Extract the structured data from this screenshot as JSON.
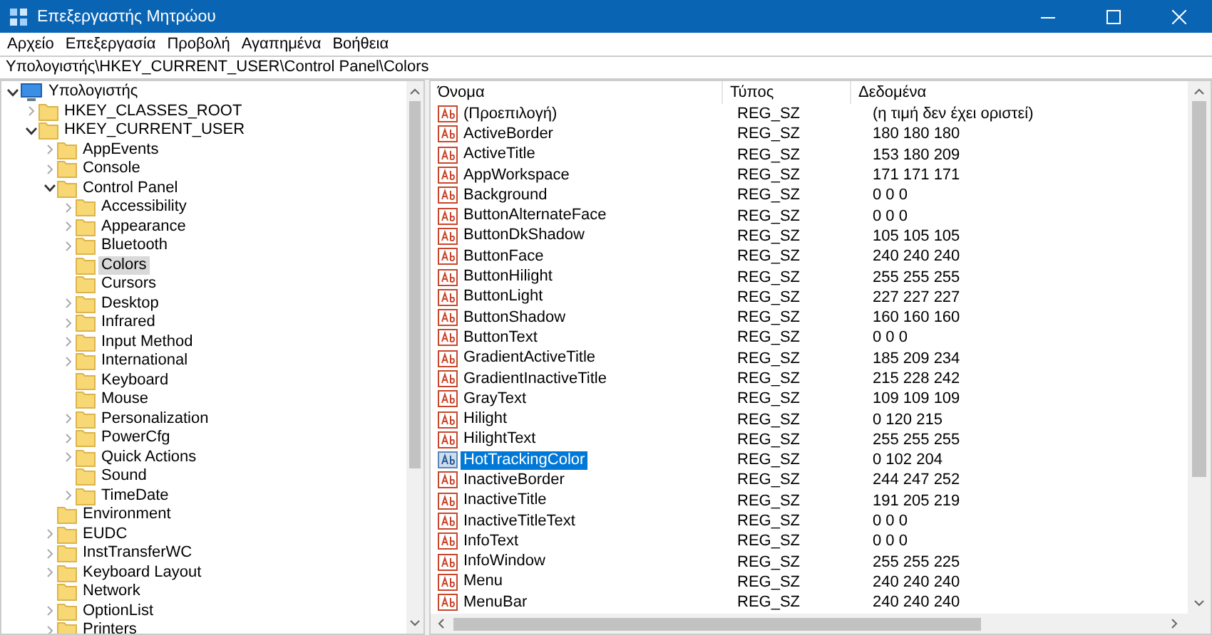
{
  "window": {
    "title": "Επεξεργαστής Μητρώου"
  },
  "menu": [
    "Αρχείο",
    "Επεξεργασία",
    "Προβολή",
    "Αγαπημένα",
    "Βοήθεια"
  ],
  "address": "Υπολογιστής\\HKEY_CURRENT_USER\\Control Panel\\Colors",
  "tree": [
    {
      "label": "Υπολογιστής",
      "kind": "computer",
      "expanded": true,
      "selected": false,
      "children": [
        {
          "label": "HKEY_CLASSES_ROOT",
          "kind": "folder",
          "expanded": false,
          "selected": false
        },
        {
          "label": "HKEY_CURRENT_USER",
          "kind": "folder",
          "expanded": true,
          "selected": false,
          "children": [
            {
              "label": "AppEvents",
              "kind": "folder",
              "expanded": false,
              "selected": false
            },
            {
              "label": "Console",
              "kind": "folder",
              "expanded": false,
              "selected": false
            },
            {
              "label": "Control Panel",
              "kind": "folder",
              "expanded": true,
              "selected": false,
              "children": [
                {
                  "label": "Accessibility",
                  "kind": "folder",
                  "expanded": false,
                  "selected": false
                },
                {
                  "label": "Appearance",
                  "kind": "folder",
                  "expanded": false,
                  "selected": false
                },
                {
                  "label": "Bluetooth",
                  "kind": "folder",
                  "expanded": false,
                  "selected": false
                },
                {
                  "label": "Colors",
                  "kind": "folder",
                  "selected": true
                },
                {
                  "label": "Cursors",
                  "kind": "folder",
                  "selected": false
                },
                {
                  "label": "Desktop",
                  "kind": "folder",
                  "expanded": false,
                  "selected": false
                },
                {
                  "label": "Infrared",
                  "kind": "folder",
                  "expanded": false,
                  "selected": false
                },
                {
                  "label": "Input Method",
                  "kind": "folder",
                  "expanded": false,
                  "selected": false
                },
                {
                  "label": "International",
                  "kind": "folder",
                  "expanded": false,
                  "selected": false
                },
                {
                  "label": "Keyboard",
                  "kind": "folder",
                  "selected": false
                },
                {
                  "label": "Mouse",
                  "kind": "folder",
                  "selected": false
                },
                {
                  "label": "Personalization",
                  "kind": "folder",
                  "expanded": false,
                  "selected": false
                },
                {
                  "label": "PowerCfg",
                  "kind": "folder",
                  "expanded": false,
                  "selected": false
                },
                {
                  "label": "Quick Actions",
                  "kind": "folder",
                  "expanded": false,
                  "selected": false
                },
                {
                  "label": "Sound",
                  "kind": "folder",
                  "selected": false
                },
                {
                  "label": "TimeDate",
                  "kind": "folder",
                  "expanded": false,
                  "selected": false
                }
              ]
            },
            {
              "label": "Environment",
              "kind": "folder",
              "selected": false
            },
            {
              "label": "EUDC",
              "kind": "folder",
              "expanded": false,
              "selected": false
            },
            {
              "label": "InstTransferWC",
              "kind": "folder",
              "expanded": false,
              "selected": false
            },
            {
              "label": "Keyboard Layout",
              "kind": "folder",
              "expanded": false,
              "selected": false
            },
            {
              "label": "Network",
              "kind": "folder",
              "selected": false
            },
            {
              "label": "OptionList",
              "kind": "folder",
              "expanded": false,
              "selected": false
            },
            {
              "label": "Printers",
              "kind": "folder",
              "expanded": false,
              "selected": false
            }
          ]
        }
      ]
    }
  ],
  "table": {
    "columns": [
      "Όνομα",
      "Τύπος",
      "Δεδομένα"
    ],
    "rows": [
      {
        "name": "(Προεπιλογή)",
        "type": "REG_SZ",
        "data": "(η τιμή δεν έχει οριστεί)",
        "selected": false
      },
      {
        "name": "ActiveBorder",
        "type": "REG_SZ",
        "data": "180 180 180",
        "selected": false
      },
      {
        "name": "ActiveTitle",
        "type": "REG_SZ",
        "data": "153 180 209",
        "selected": false
      },
      {
        "name": "AppWorkspace",
        "type": "REG_SZ",
        "data": "171 171 171",
        "selected": false
      },
      {
        "name": "Background",
        "type": "REG_SZ",
        "data": "0 0 0",
        "selected": false
      },
      {
        "name": "ButtonAlternateFace",
        "type": "REG_SZ",
        "data": "0 0 0",
        "selected": false
      },
      {
        "name": "ButtonDkShadow",
        "type": "REG_SZ",
        "data": "105 105 105",
        "selected": false
      },
      {
        "name": "ButtonFace",
        "type": "REG_SZ",
        "data": "240 240 240",
        "selected": false
      },
      {
        "name": "ButtonHilight",
        "type": "REG_SZ",
        "data": "255 255 255",
        "selected": false
      },
      {
        "name": "ButtonLight",
        "type": "REG_SZ",
        "data": "227 227 227",
        "selected": false
      },
      {
        "name": "ButtonShadow",
        "type": "REG_SZ",
        "data": "160 160 160",
        "selected": false
      },
      {
        "name": "ButtonText",
        "type": "REG_SZ",
        "data": "0 0 0",
        "selected": false
      },
      {
        "name": "GradientActiveTitle",
        "type": "REG_SZ",
        "data": "185 209 234",
        "selected": false
      },
      {
        "name": "GradientInactiveTitle",
        "type": "REG_SZ",
        "data": "215 228 242",
        "selected": false
      },
      {
        "name": "GrayText",
        "type": "REG_SZ",
        "data": "109 109 109",
        "selected": false
      },
      {
        "name": "Hilight",
        "type": "REG_SZ",
        "data": "0 120 215",
        "selected": false
      },
      {
        "name": "HilightText",
        "type": "REG_SZ",
        "data": "255 255 255",
        "selected": false
      },
      {
        "name": "HotTrackingColor",
        "type": "REG_SZ",
        "data": "0 102 204",
        "selected": true
      },
      {
        "name": "InactiveBorder",
        "type": "REG_SZ",
        "data": "244 247 252",
        "selected": false
      },
      {
        "name": "InactiveTitle",
        "type": "REG_SZ",
        "data": "191 205 219",
        "selected": false
      },
      {
        "name": "InactiveTitleText",
        "type": "REG_SZ",
        "data": "0 0 0",
        "selected": false
      },
      {
        "name": "InfoText",
        "type": "REG_SZ",
        "data": "0 0 0",
        "selected": false
      },
      {
        "name": "InfoWindow",
        "type": "REG_SZ",
        "data": "255 255 225",
        "selected": false
      },
      {
        "name": "Menu",
        "type": "REG_SZ",
        "data": "240 240 240",
        "selected": false
      },
      {
        "name": "MenuBar",
        "type": "REG_SZ",
        "data": "240 240 240",
        "selected": false
      }
    ]
  }
}
